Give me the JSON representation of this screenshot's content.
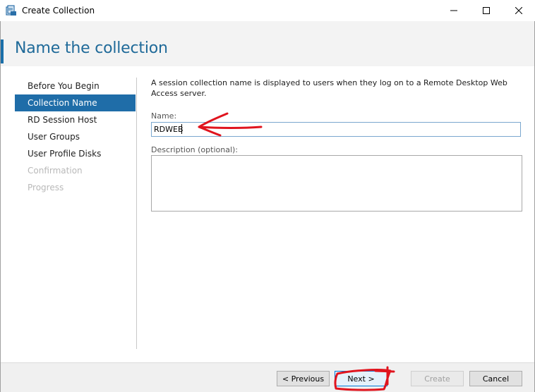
{
  "window": {
    "title": "Create Collection",
    "controls": [
      "minimize-icon",
      "maximize-icon",
      "close-icon"
    ]
  },
  "page": {
    "title": "Name the collection"
  },
  "nav": {
    "items": [
      {
        "label": "Before You Begin",
        "state": "normal"
      },
      {
        "label": "Collection Name",
        "state": "selected"
      },
      {
        "label": "RD Session Host",
        "state": "normal"
      },
      {
        "label": "User Groups",
        "state": "normal"
      },
      {
        "label": "User Profile Disks",
        "state": "normal"
      },
      {
        "label": "Confirmation",
        "state": "disabled"
      },
      {
        "label": "Progress",
        "state": "disabled"
      }
    ]
  },
  "content": {
    "intro": "A session collection name is displayed to users when they log on to a Remote Desktop Web Access server.",
    "name_label": "Name:",
    "name_value": "RDWEB",
    "description_label": "Description (optional):",
    "description_value": ""
  },
  "footer": {
    "previous_label": "< Previous",
    "next_label": "Next >",
    "create_label": "Create",
    "cancel_label": "Cancel"
  },
  "colors": {
    "accent": "#1f6da8",
    "title": "#1f6a99",
    "annotation": "#e0141e"
  }
}
